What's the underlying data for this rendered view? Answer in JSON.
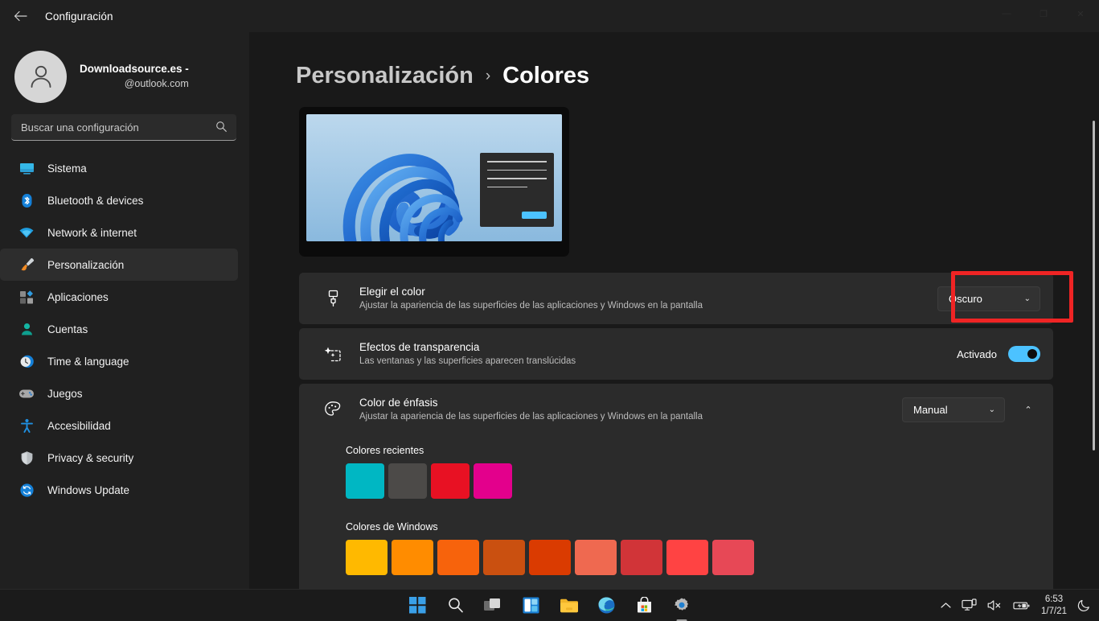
{
  "window": {
    "title": "Configuración",
    "back_icon": "back-arrow-icon",
    "minimize": "—",
    "maximize": "❐",
    "close": "✕"
  },
  "account": {
    "name": "Downloadsource.es -",
    "email": "@outlook.com",
    "avatar_icon": "user-avatar-icon"
  },
  "search": {
    "placeholder": "Buscar una configuración",
    "value": "",
    "icon": "search-icon"
  },
  "sidebar": {
    "items": [
      {
        "label": "Sistema",
        "icon": "system-icon",
        "selected": false
      },
      {
        "label": "Bluetooth & devices",
        "icon": "bluetooth-icon",
        "selected": false
      },
      {
        "label": "Network & internet",
        "icon": "wifi-icon",
        "selected": false
      },
      {
        "label": "Personalización",
        "icon": "paintbrush-icon",
        "selected": true
      },
      {
        "label": "Aplicaciones",
        "icon": "apps-icon",
        "selected": false
      },
      {
        "label": "Cuentas",
        "icon": "accounts-icon",
        "selected": false
      },
      {
        "label": "Time & language",
        "icon": "clock-icon",
        "selected": false
      },
      {
        "label": "Juegos",
        "icon": "gamepad-icon",
        "selected": false
      },
      {
        "label": "Accesibilidad",
        "icon": "accessibility-icon",
        "selected": false
      },
      {
        "label": "Privacy & security",
        "icon": "shield-icon",
        "selected": false
      },
      {
        "label": "Windows Update",
        "icon": "update-icon",
        "selected": false
      }
    ]
  },
  "breadcrumb": {
    "parent": "Personalización",
    "separator": "›",
    "current": "Colores"
  },
  "preview": {
    "name": "theme-preview-monitor"
  },
  "settings": {
    "choose_color": {
      "title": "Elegir el color",
      "subtitle": "Ajustar la apariencia de las superficies de las aplicaciones y Windows en la pantalla",
      "icon": "paintbrush-icon",
      "dropdown_value": "Oscuro",
      "chevron": "⌄",
      "highlighted": true
    },
    "transparency": {
      "title": "Efectos de transparencia",
      "subtitle": "Las ventanas y las superficies aparecen translúcidas",
      "icon": "transparency-sparkle-icon",
      "toggle_label": "Activado",
      "toggle_on": true
    },
    "accent_color": {
      "title": "Color de énfasis",
      "subtitle": "Ajustar la apariencia de las superficies de las aplicaciones y Windows en la pantalla",
      "icon": "palette-icon",
      "dropdown_value": "Manual",
      "chevron": "⌄",
      "expander": "⌃"
    }
  },
  "swatches": {
    "recent_label": "Colores recientes",
    "recent": [
      "#00b7c3",
      "#4c4a48",
      "#e81123",
      "#e3008c"
    ],
    "windows_label": "Colores de Windows",
    "windows": [
      "#ffb900",
      "#ff8c00",
      "#f7630c",
      "#ca5010",
      "#da3b01",
      "#ef6950",
      "#d13438",
      "#ff4343",
      "#e74856"
    ]
  },
  "annotation": {
    "color": "#ef2424",
    "target": "choose-color-dropdown"
  },
  "taskbar": {
    "icons": [
      {
        "name": "start-icon",
        "active": false
      },
      {
        "name": "search-icon",
        "active": false
      },
      {
        "name": "task-view-icon",
        "active": false
      },
      {
        "name": "widgets-icon",
        "active": false
      },
      {
        "name": "file-explorer-icon",
        "active": false
      },
      {
        "name": "edge-browser-icon",
        "active": false
      },
      {
        "name": "microsoft-store-icon",
        "active": false
      },
      {
        "name": "settings-gear-icon",
        "active": true
      }
    ],
    "tray": {
      "chevron": "⌃",
      "network_icon": "network-display-icon",
      "volume_icon": "volume-muted-icon",
      "battery_icon": "battery-charging-icon",
      "time": "6:53",
      "date": "1/7/21",
      "focus_icon": "moon-focus-icon"
    }
  }
}
